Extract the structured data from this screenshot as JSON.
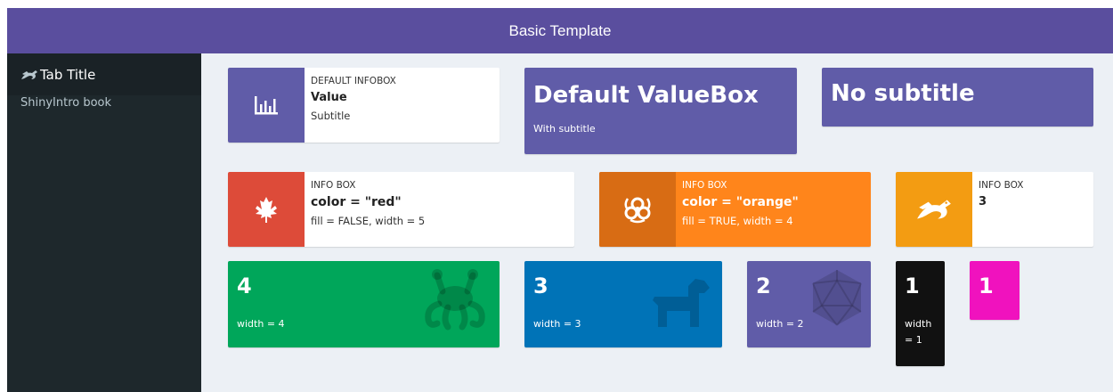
{
  "header": {
    "title": "Basic Template"
  },
  "sidebar": {
    "title": "Tab Title",
    "items": [
      {
        "label": "ShinyIntro book"
      }
    ]
  },
  "colors": {
    "header": "#5a4e9e",
    "purple": "#605ca8",
    "red": "#dd4b39",
    "orange": "#ff851b",
    "orange_dark": "#d86c14",
    "yellow": "#f39c12",
    "green": "#00a65a",
    "blue": "#0073b7",
    "black": "#111111",
    "fuchsia": "#f012be"
  },
  "infoboxes": {
    "default": {
      "label": "DEFAULT INFOBOX",
      "value": "Value",
      "subtitle": "Subtitle",
      "icon": "chart-bar-icon"
    },
    "red": {
      "label": "INFO BOX",
      "value": "color = \"red\"",
      "subtitle": "fill = FALSE, width = 5",
      "icon": "canadian-maple-leaf-icon"
    },
    "orange": {
      "label": "INFO BOX",
      "value": "color = \"orange\"",
      "subtitle": "fill = TRUE, width = 4",
      "icon": "biohazard-icon"
    },
    "yellow": {
      "label": "INFO BOX",
      "value": "3",
      "icon": "dragon-icon"
    }
  },
  "valueboxes": {
    "default": {
      "value": "Default ValueBox",
      "subtitle": "With subtitle"
    },
    "nosub": {
      "value": "No subtitle"
    },
    "green": {
      "value": "4",
      "subtitle": "width = 4",
      "icon": "flying-spaghetti-monster-icon"
    },
    "blue": {
      "value": "3",
      "subtitle": "width = 3",
      "icon": "dog-icon"
    },
    "purple": {
      "value": "2",
      "subtitle": "width = 2",
      "icon": "dice-d20-icon"
    },
    "black": {
      "value": "1",
      "subtitle_1": "width",
      "subtitle_2": "= 1"
    },
    "fuchsia": {
      "value": "1"
    }
  }
}
